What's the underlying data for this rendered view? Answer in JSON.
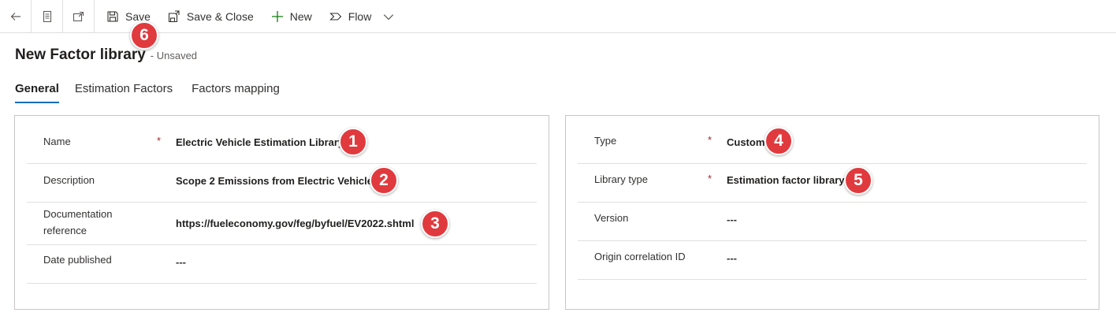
{
  "toolbar": {
    "save_label": "Save",
    "save_close_label": "Save & Close",
    "new_label": "New",
    "flow_label": "Flow"
  },
  "header": {
    "title": "New Factor library",
    "status": "- Unsaved"
  },
  "tabs": [
    {
      "label": "General",
      "active": true
    },
    {
      "label": "Estimation Factors",
      "active": false
    },
    {
      "label": "Factors mapping",
      "active": false
    }
  ],
  "left_panel": {
    "fields": [
      {
        "label": "Name",
        "required": true,
        "value": "Electric Vehicle Estimation Library"
      },
      {
        "label": "Description",
        "required": false,
        "value": "Scope 2 Emissions from Electric Vehicles"
      },
      {
        "label_line1": "Documentation",
        "label_line2": "reference",
        "required": false,
        "value": "https://fueleconomy.gov/feg/byfuel/EV2022.shtml"
      },
      {
        "label": "Date published",
        "required": false,
        "value": "---"
      }
    ]
  },
  "right_panel": {
    "fields": [
      {
        "label": "Type",
        "required": true,
        "value": "Custom"
      },
      {
        "label": "Library type",
        "required": true,
        "value": "Estimation factor library"
      },
      {
        "label": "Version",
        "required": false,
        "value": "---"
      },
      {
        "label": "Origin correlation ID",
        "required": false,
        "value": "---"
      }
    ]
  },
  "required_marker": "*",
  "callouts": [
    "1",
    "2",
    "3",
    "4",
    "5",
    "6"
  ],
  "colors": {
    "accent": "#0f6cbd",
    "callout": "#e03a3e",
    "required": "#a4262c",
    "new_plus": "#107c10"
  }
}
